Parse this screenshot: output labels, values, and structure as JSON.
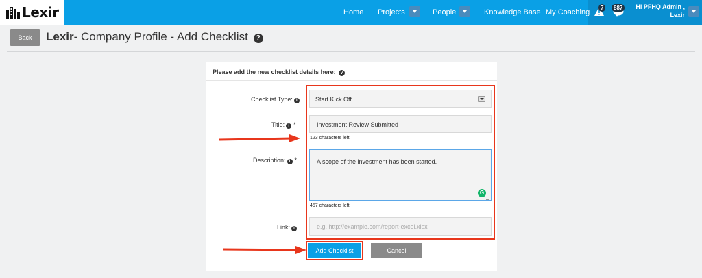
{
  "app": {
    "logo_text": "Lexir"
  },
  "nav": {
    "items": [
      {
        "label": "Home"
      },
      {
        "label": "Projects"
      },
      {
        "label": "People"
      },
      {
        "label": "Knowledge Base"
      },
      {
        "label": "My Coaching"
      }
    ],
    "alerts_count": "7",
    "messages_count": "887",
    "user_greeting_line1": "Hi PFHQ Admin ,",
    "user_greeting_line2": "Lexir"
  },
  "header": {
    "back_label": "Back",
    "title_bold": "Lexir",
    "title_rest": "- Company Profile - Add Checklist"
  },
  "form": {
    "intro": "Please add the new checklist details here:",
    "checklist_type_label": "Checklist Type:",
    "checklist_type_value": "Start Kick Off",
    "title_label": "Title:",
    "title_value": "Investment Review Submitted",
    "title_counter": "123 characters left",
    "description_label": "Description:",
    "description_value": "A scope of the investment has been started.",
    "description_counter": "457 characters left",
    "link_label": "Link:",
    "link_placeholder": "e.g. http://example.com/report-excel.xlsx",
    "required_mark": "*",
    "add_button": "Add Checklist",
    "cancel_button": "Cancel"
  },
  "colors": {
    "nav_bg": "#0aa0e6",
    "annotation_red": "#e8361c",
    "primary_button": "#0aa0e6",
    "secondary_button": "#8a8a8a"
  }
}
